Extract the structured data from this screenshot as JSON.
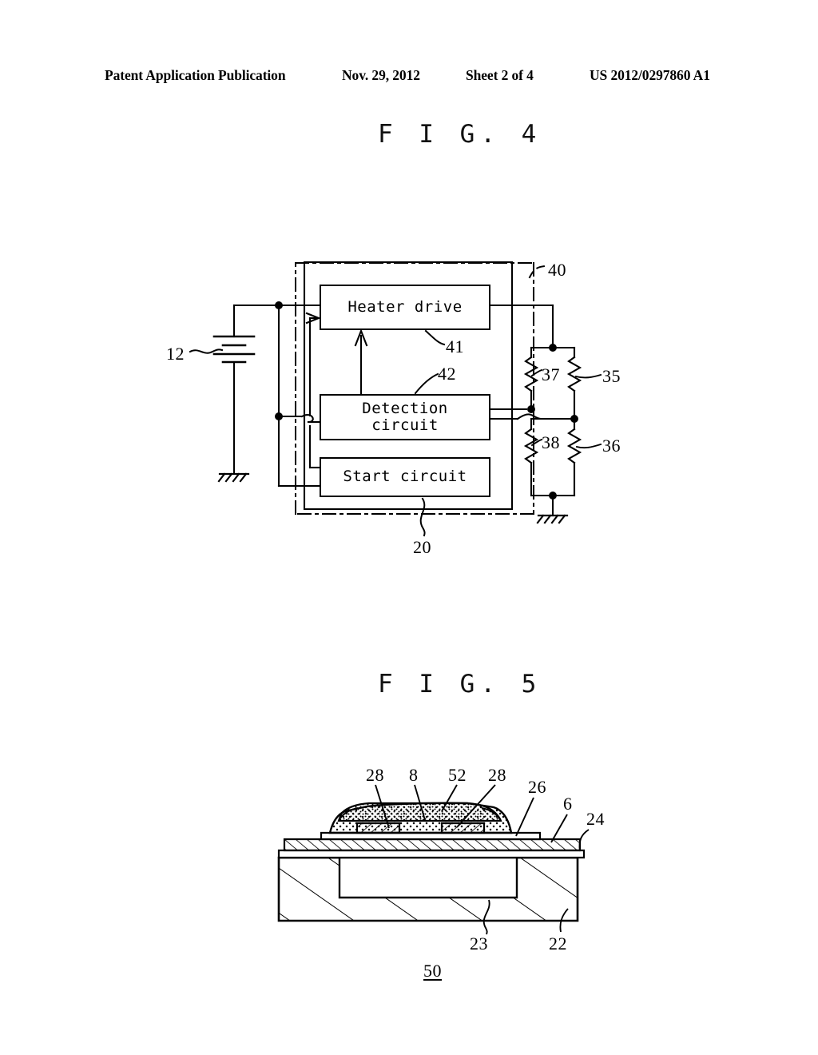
{
  "header": {
    "left": "Patent Application Publication",
    "date": "Nov. 29, 2012",
    "sheet": "Sheet 2 of 4",
    "publication_number": "US 2012/0297860 A1"
  },
  "figures": [
    {
      "id": "fig4",
      "title": "F I G.  4",
      "type": "block-circuit-diagram",
      "blocks": [
        {
          "ref": "41",
          "label": "Heater drive"
        },
        {
          "ref": "42",
          "label": "Detection\ncircuit"
        },
        {
          "ref": "",
          "label": "Start circuit"
        }
      ],
      "callouts": [
        {
          "ref": "12",
          "target": "battery"
        },
        {
          "ref": "40",
          "target": "dash-dot-enclosure"
        },
        {
          "ref": "41",
          "target": "heater-drive-block"
        },
        {
          "ref": "42",
          "target": "detection-circuit-block"
        },
        {
          "ref": "37",
          "target": "resistor-upper-left"
        },
        {
          "ref": "35",
          "target": "resistor-upper-right"
        },
        {
          "ref": "38",
          "target": "resistor-lower-left"
        },
        {
          "ref": "36",
          "target": "resistor-lower-right"
        },
        {
          "ref": "20",
          "target": "solid-enclosure"
        }
      ]
    },
    {
      "id": "fig5",
      "title": "F I G.  5",
      "type": "cross-section-diagram",
      "figure_designation": "50",
      "callouts": [
        {
          "ref": "28",
          "target": "electrode-left"
        },
        {
          "ref": "8",
          "target": "sensing-film"
        },
        {
          "ref": "52",
          "target": "upper-protective-layer"
        },
        {
          "ref": "28",
          "target": "electrode-right"
        },
        {
          "ref": "26",
          "target": "membrane-pad"
        },
        {
          "ref": "6",
          "target": "membrane-layer"
        },
        {
          "ref": "24",
          "target": "insulating-layer"
        },
        {
          "ref": "23",
          "target": "substrate-cavity"
        },
        {
          "ref": "22",
          "target": "substrate"
        }
      ]
    }
  ],
  "fig4_labels": {
    "heater_drive": "Heater drive",
    "detection_circuit": "Detection\ncircuit",
    "start_circuit": "Start circuit",
    "ref_12": "12",
    "ref_40": "40",
    "ref_41": "41",
    "ref_42": "42",
    "ref_37": "37",
    "ref_35": "35",
    "ref_38": "38",
    "ref_36": "36",
    "ref_20": "20",
    "title": "F I G.  4"
  },
  "fig5_labels": {
    "ref_28a": "28",
    "ref_8": "8",
    "ref_52": "52",
    "ref_28b": "28",
    "ref_26": "26",
    "ref_6": "6",
    "ref_24": "24",
    "ref_23": "23",
    "ref_22": "22",
    "ref_50": "50",
    "title": "F I G.  5"
  },
  "colors": {
    "ink": "#000000",
    "paper": "#ffffff"
  }
}
